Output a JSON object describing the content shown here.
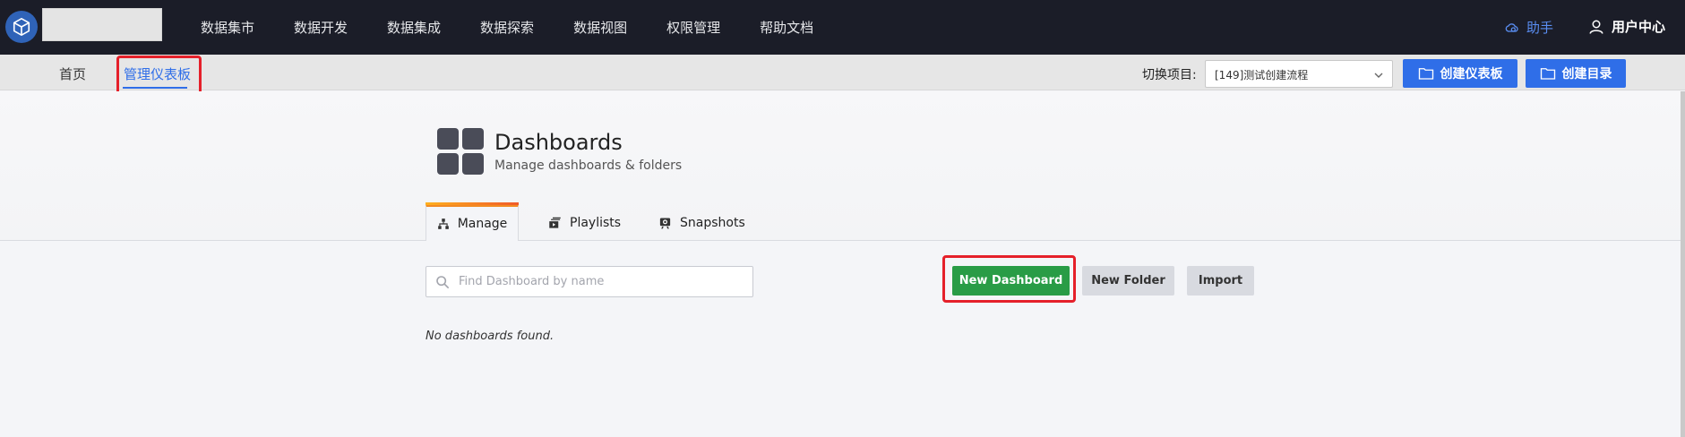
{
  "topbar": {
    "nav_items": [
      "数据集市",
      "数据开发",
      "数据集成",
      "数据探索",
      "数据视图",
      "权限管理",
      "帮助文档"
    ],
    "helper_label": "助手",
    "user_label": "用户中心"
  },
  "subbar": {
    "tabs": [
      {
        "label": "首页",
        "active": false
      },
      {
        "label": "管理仪表板",
        "active": true
      }
    ],
    "switch_label": "切换项目:",
    "project_selected": "[149]测试创建流程",
    "create_dashboard_label": "创建仪表板",
    "create_folder_label": "创建目录"
  },
  "page": {
    "title": "Dashboards",
    "subtitle": "Manage dashboards & folders",
    "tabs": [
      {
        "label": "Manage",
        "icon": "sitemap-icon",
        "active": true
      },
      {
        "label": "Playlists",
        "icon": "playlist-icon",
        "active": false
      },
      {
        "label": "Snapshots",
        "icon": "camera-icon",
        "active": false
      }
    ],
    "search_placeholder": "Find Dashboard by name",
    "new_dashboard_label": "New Dashboard",
    "new_folder_label": "New Folder",
    "import_label": "Import",
    "empty_message": "No dashboards found."
  },
  "colors": {
    "topbar_bg": "#1b1d28",
    "accent_blue": "#2f6ee8",
    "green": "#299c46",
    "highlight_red": "#e5202a",
    "tab_accent": "#f28a22"
  }
}
